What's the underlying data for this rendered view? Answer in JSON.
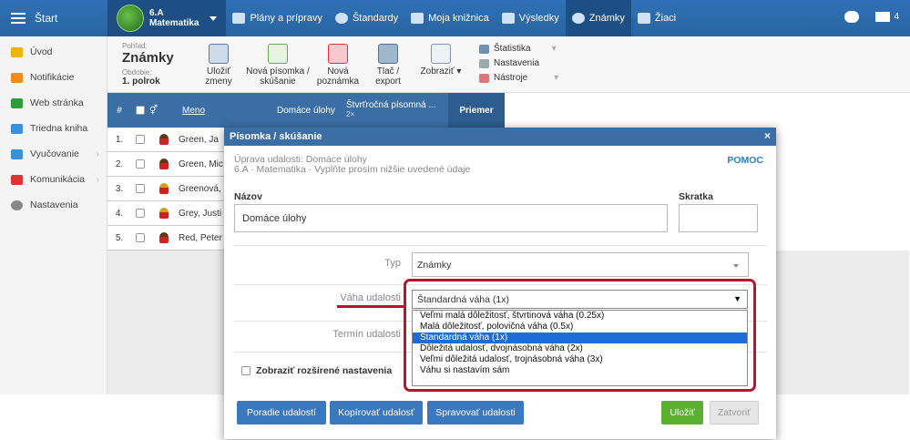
{
  "topbar": {
    "start_label": "Štart",
    "class_name": "6.A",
    "class_subject": "Matematika",
    "nav": [
      {
        "label": "Plány a prípravy",
        "icon": "plans-icon"
      },
      {
        "label": "Štandardy",
        "icon": "shield-icon"
      },
      {
        "label": "Moja knižnica",
        "icon": "library-icon"
      },
      {
        "label": "Výsledky",
        "icon": "chart-icon"
      },
      {
        "label": "Známky",
        "icon": "grades-icon"
      },
      {
        "label": "Žiaci",
        "icon": "students-icon"
      }
    ],
    "mail_count": "4"
  },
  "sidebar": {
    "items": [
      {
        "label": "Úvod",
        "color": "#f0b400"
      },
      {
        "label": "Notifikácie",
        "color": "#f08a1c"
      },
      {
        "label": "Web stránka",
        "color": "#2e9b3a"
      },
      {
        "label": "Triedna kniha",
        "color": "#3a8fd6"
      },
      {
        "label": "Vyučovanie",
        "color": "#3a8fd6",
        "arrow": "›"
      },
      {
        "label": "Komunikácia",
        "color": "#d33",
        "arrow": "›"
      },
      {
        "label": "Nastavenia",
        "color": "#888"
      }
    ]
  },
  "toolbar": {
    "view_label": "Pohľad:",
    "view_value": "Známky",
    "period_label": "Obdobie:",
    "period_value": "1. polrok",
    "save": "Uložiť zmeny",
    "new_exam": "Nová písomka / skúšanie",
    "new_note": "Nová poznámka",
    "print": "Tlač / export",
    "show": "Zobraziť",
    "menu": [
      "Štatistika",
      "Nastavenia",
      "Nástroje"
    ]
  },
  "grid": {
    "headers": {
      "num": "#",
      "name": "Meno",
      "col1": "Domáce úlohy",
      "col2": "Štvrťročná písomná ...",
      "col2_sub": "2×",
      "avg": "Priemer"
    },
    "rows": [
      {
        "num": "1.",
        "name": "Green, Ja"
      },
      {
        "num": "2.",
        "name": "Green, Mic"
      },
      {
        "num": "3.",
        "name": "Greenová,"
      },
      {
        "num": "4.",
        "name": "Grey, Justi"
      },
      {
        "num": "5.",
        "name": "Red, Peter"
      }
    ]
  },
  "modal": {
    "title": "Písomka / skúšanie",
    "close": "×",
    "subtitle1": "Úprava udalosti: Domáce úlohy",
    "subtitle2": "6.A · Matematika · Vyplňte prosím nižšie uvedené údaje",
    "help": "POMOC",
    "name_label": "Názov",
    "name_value": "Domáce úlohy",
    "short_label": "Skratka",
    "short_value": "",
    "type_label": "Typ",
    "type_value": "Známky",
    "weight_label": "Váha udalosti",
    "weight_value": "Štandardná váha (1x)",
    "date_label": "Termín udalosti",
    "advanced_label": "Zobraziť rozšírené nastavenia",
    "weight_options": [
      "Veľmi malá dôležitosť, štvrtinová váha (0.25x)",
      "Malá dôležitosť, polovičná váha (0.5x)",
      "Štandardná váha (1x)",
      "Dôležitá udalosť, dvojnásobná váha (2x)",
      "Veľmi dôležitá udalosť, trojnásobná váha (3x)",
      "Váhu si nastavím sám"
    ],
    "selected_index": 2,
    "buttons": {
      "order": "Poradie udalostí",
      "copy": "Kopírovať udalosť",
      "manage": "Spravovať udalosti",
      "save": "Uložiť",
      "close": "Zatvoriť"
    }
  },
  "colors": {
    "header": "#3a6ea5",
    "accent_red": "#b5162b",
    "save_green": "#5cb030"
  }
}
